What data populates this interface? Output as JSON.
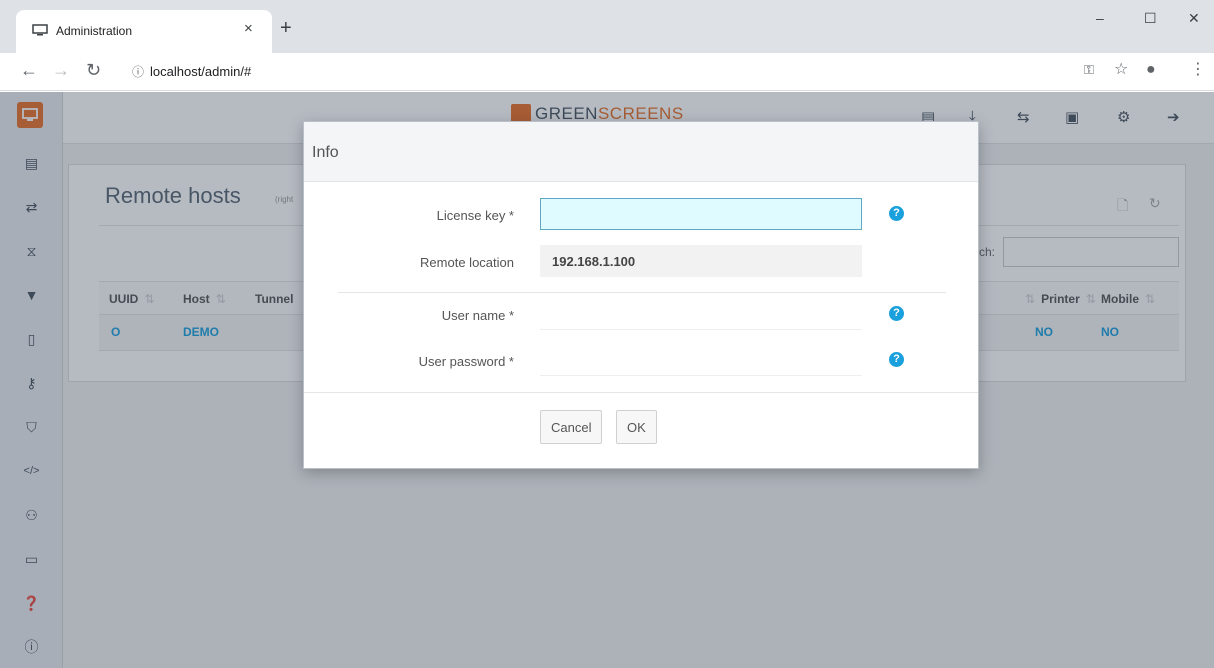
{
  "browser": {
    "tab_title": "Administration",
    "tab_close": "×",
    "new_tab": "+",
    "url": "localhost/admin/#",
    "window_controls": {
      "minimize": "–",
      "maximize": "☐",
      "close": "✕"
    }
  },
  "app": {
    "brand": {
      "part1": "GREEN",
      "part2": "SCREENS"
    },
    "accent_color": "#e8712a",
    "link_color": "#1aa0dc",
    "sidebar_icons": [
      "list-icon",
      "transfer-icon",
      "sitemap-icon",
      "filter-icon",
      "mobile-icon",
      "key-icon",
      "shield-icon",
      "code-icon",
      "users-icon",
      "desktop-icon",
      "question-icon",
      "info-icon"
    ],
    "top_icons": [
      "window-icon",
      "download-icon",
      "retweet-icon",
      "id-card-icon",
      "gears-icon",
      "sign-out-icon"
    ]
  },
  "panel": {
    "title": "Remote hosts",
    "subtitle": "(right",
    "search_label": "ch:",
    "columns_left": [
      "UUID",
      "Host",
      "Tunnel"
    ],
    "columns_right": [
      "Printer",
      "Mobile"
    ],
    "row_left": [
      "O",
      "DEMO"
    ],
    "row_right": [
      "NO",
      "NO"
    ]
  },
  "modal": {
    "title": "Info",
    "license_label": "License key *",
    "license_value": "",
    "location_label": "Remote location",
    "location_value": "192.168.1.100",
    "username_label": "User name *",
    "username_value": "",
    "password_label": "User password *",
    "password_value": "",
    "help_glyph": "?",
    "cancel_label": "Cancel",
    "ok_label": "OK"
  }
}
